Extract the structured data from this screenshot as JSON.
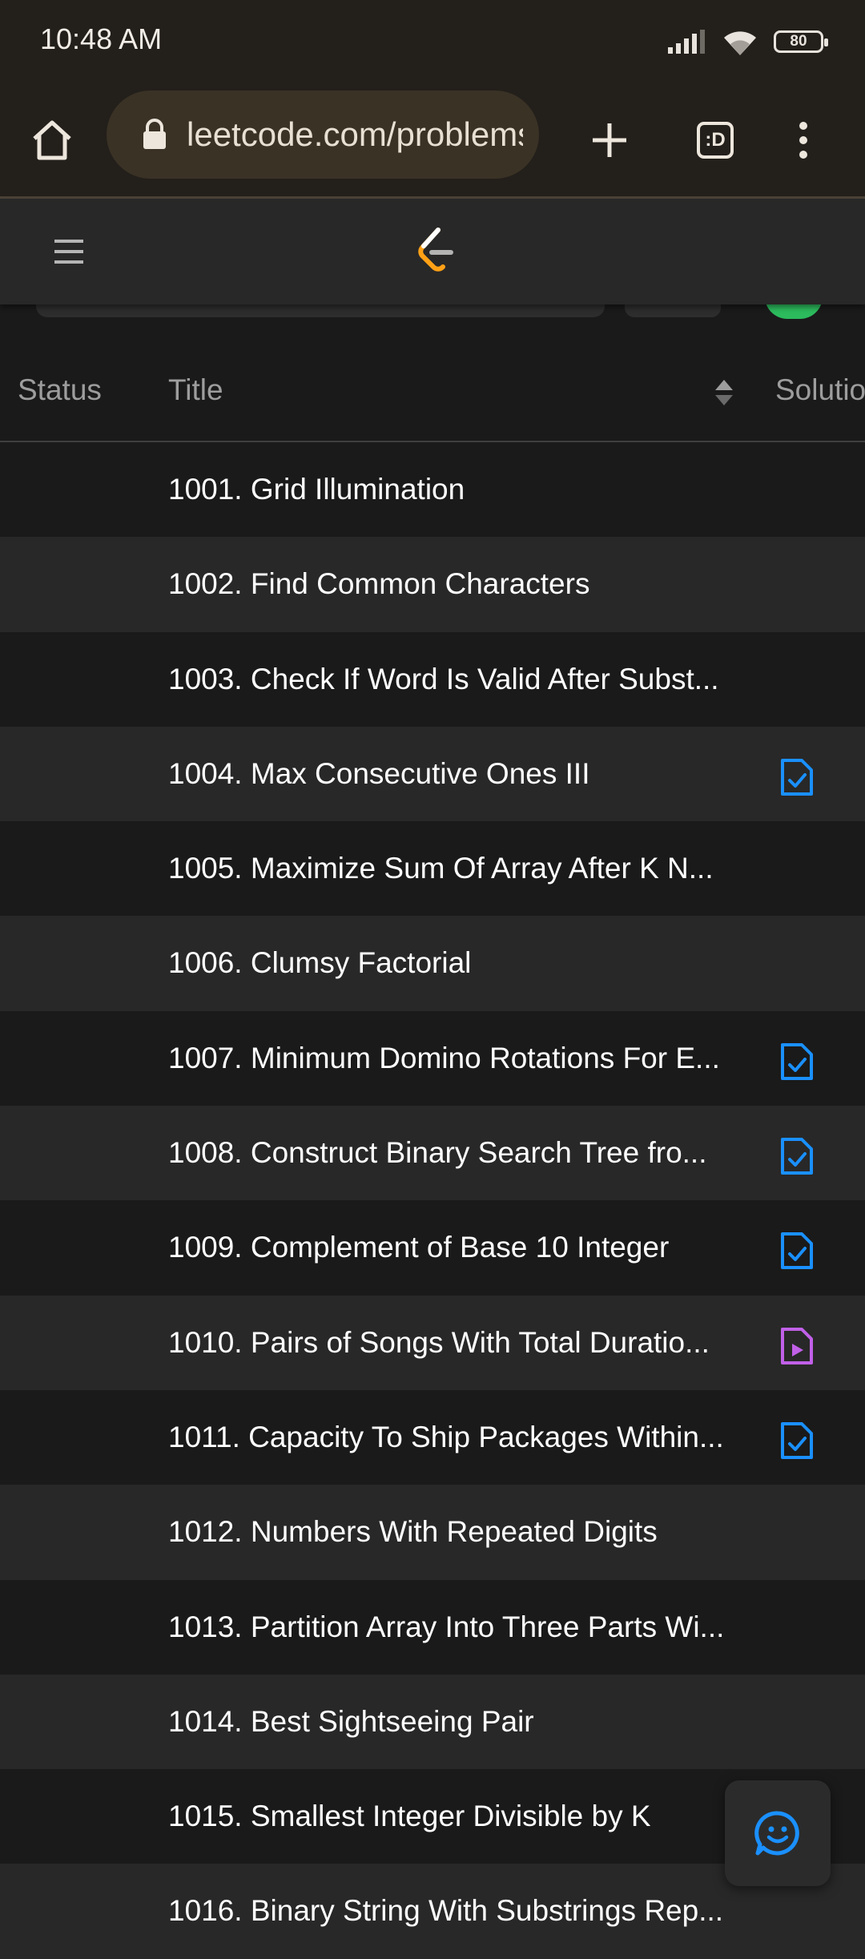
{
  "status_bar": {
    "time": "10:48 AM",
    "battery": "80"
  },
  "browser": {
    "url": "leetcode.com/problems",
    "tabs_label": ":D"
  },
  "table": {
    "headers": {
      "status": "Status",
      "title": "Title",
      "solution": "Solution"
    },
    "rows": [
      {
        "title": "1001. Grid Illumination",
        "solution": "none"
      },
      {
        "title": "1002. Find Common Characters",
        "solution": "none"
      },
      {
        "title": "1003. Check If Word Is Valid After Subst...",
        "solution": "none"
      },
      {
        "title": "1004. Max Consecutive Ones III",
        "solution": "article"
      },
      {
        "title": "1005. Maximize Sum Of Array After K N...",
        "solution": "none"
      },
      {
        "title": "1006. Clumsy Factorial",
        "solution": "none"
      },
      {
        "title": "1007. Minimum Domino Rotations For E...",
        "solution": "article"
      },
      {
        "title": "1008. Construct Binary Search Tree fro...",
        "solution": "article"
      },
      {
        "title": "1009. Complement of Base 10 Integer",
        "solution": "article"
      },
      {
        "title": "1010. Pairs of Songs With Total Duratio...",
        "solution": "video"
      },
      {
        "title": "1011. Capacity To Ship Packages Within...",
        "solution": "article"
      },
      {
        "title": "1012. Numbers With Repeated Digits",
        "solution": "none"
      },
      {
        "title": "1013. Partition Array Into Three Parts Wi...",
        "solution": "none"
      },
      {
        "title": "1014. Best Sightseeing Pair",
        "solution": "none"
      },
      {
        "title": "1015. Smallest Integer Divisible by K",
        "solution": "none"
      },
      {
        "title": "1016. Binary String With Substrings Rep...",
        "solution": "none"
      }
    ]
  },
  "colors": {
    "article_icon": "#1a90ff",
    "video_icon": "#c160e8",
    "accent_green": "#2cbb5d",
    "logo_orange": "#ffa116"
  }
}
